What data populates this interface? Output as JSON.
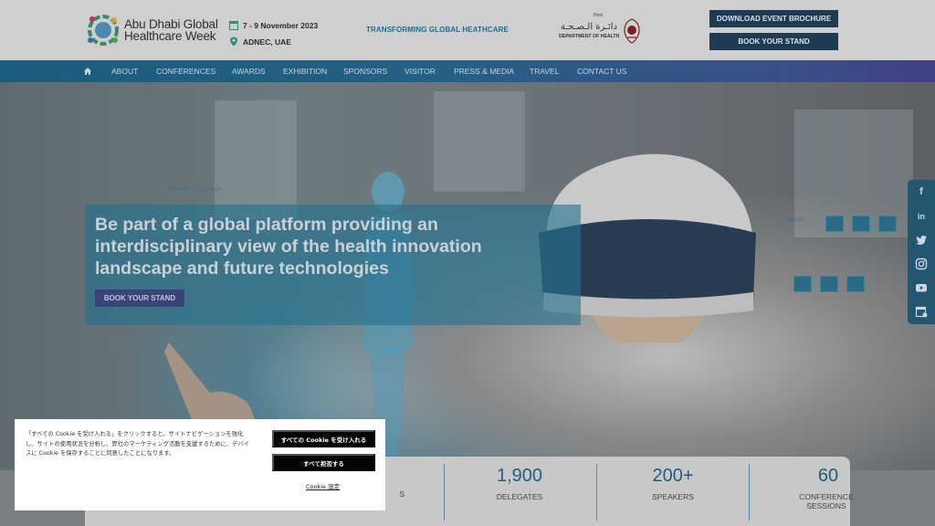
{
  "header": {
    "logo_line1": "Abu Dhabi Global",
    "logo_line2": "Healthcare Week",
    "event_date": "7 - 9 November 2023",
    "event_venue": "ADNEC, UAE",
    "tagline": "TRANSFORMING GLOBAL HEATHCARE",
    "host_label": "Host",
    "host_arabic": "دائـرة الـصـحـة",
    "host_dept": "DEPARTMENT OF HEALTH",
    "btn_brochure": "DOWNLOAD EVENT BROCHURE",
    "btn_stand": "BOOK YOUR STAND"
  },
  "nav": {
    "items": [
      "ABOUT",
      "CONFERENCES",
      "AWARDS",
      "EXHIBITION",
      "SPONSORS",
      "VISITOR",
      "PRESS & MEDIA",
      "TRAVEL",
      "CONTACT US"
    ]
  },
  "hero": {
    "title": "Be part of a global platform providing an interdisciplinary view of the health innovation landscape and future technologies",
    "cta": "BOOK YOUR STAND"
  },
  "social": [
    "f",
    "in",
    "twitter-icon",
    "instagram-icon",
    "youtube-icon",
    "calendar-icon"
  ],
  "stats": [
    {
      "num": "",
      "lbl": "S"
    },
    {
      "num": "1,900",
      "lbl": "DELEGATES"
    },
    {
      "num": "200+",
      "lbl": "SPEAKERS"
    },
    {
      "num": "60",
      "lbl": "CONFERENCE SESSIONS"
    }
  ],
  "cookie": {
    "text": "「すべての Cookie を受け入れる」をクリックすると、サイトナビゲーションを強化し、サイトの使用状況を分析し、弊社のマーケティング活動を支援するために、デバイスに Cookie を保存することに同意したことになります。",
    "accept_all": "すべての Cookie を受け入れる",
    "reject_all": "すべて拒否する",
    "settings": "Cookie 設定"
  },
  "colors": {
    "nav_start": "#1b5d7d",
    "nav_end": "#413f84",
    "accent_teal": "#1f5f7c",
    "header_button": "#1f3a53"
  }
}
